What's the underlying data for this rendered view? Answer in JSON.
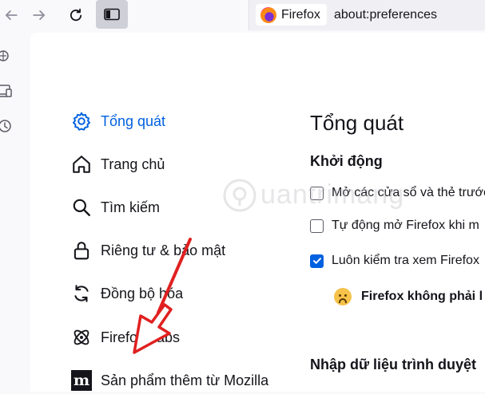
{
  "toolbar": {
    "back_icon": "arrow-left-icon",
    "forward_icon": "arrow-right-icon",
    "reload_icon": "reload-icon",
    "sidebar_icon": "sidebar-icon"
  },
  "urlbar": {
    "identity_label": "Firefox",
    "url": "about:preferences"
  },
  "side_strip": {
    "icons": [
      "ai-chatbot-icon",
      "synced-tabs-icon",
      "history-icon"
    ]
  },
  "categories": [
    {
      "label": "Tổng quát",
      "icon": "gear-icon",
      "selected": true
    },
    {
      "label": "Trang chủ",
      "icon": "home-icon",
      "selected": false
    },
    {
      "label": "Tìm kiếm",
      "icon": "search-icon",
      "selected": false
    },
    {
      "label": "Riêng tư & bảo mật",
      "icon": "lock-icon",
      "selected": false
    },
    {
      "label": "Đồng bộ hóa",
      "icon": "sync-icon",
      "selected": false
    },
    {
      "label": "Firefox Labs",
      "icon": "labs-atom-icon",
      "selected": false
    },
    {
      "label": "Sản phẩm thêm từ Mozilla",
      "icon": "mozilla-icon",
      "selected": false
    }
  ],
  "pane": {
    "title": "Tổng quát",
    "startup": {
      "title": "Khởi động",
      "options": [
        {
          "label": "Mở các cửa sổ và thẻ trước",
          "checked": false
        },
        {
          "label": "Tự động mở Firefox khi m",
          "checked": false
        },
        {
          "label": "Luôn kiểm tra xem Firefox",
          "checked": true
        }
      ],
      "warning": "Firefox không phải l"
    },
    "import": {
      "title": "Nhập dữ liệu trình duyệt"
    }
  },
  "watermark": {
    "text": "uantrimang"
  },
  "colors": {
    "accent": "#0061e0",
    "arrow": "#e02020",
    "content_bg": "#ffffff",
    "chrome_bg": "#f9f9fb"
  }
}
